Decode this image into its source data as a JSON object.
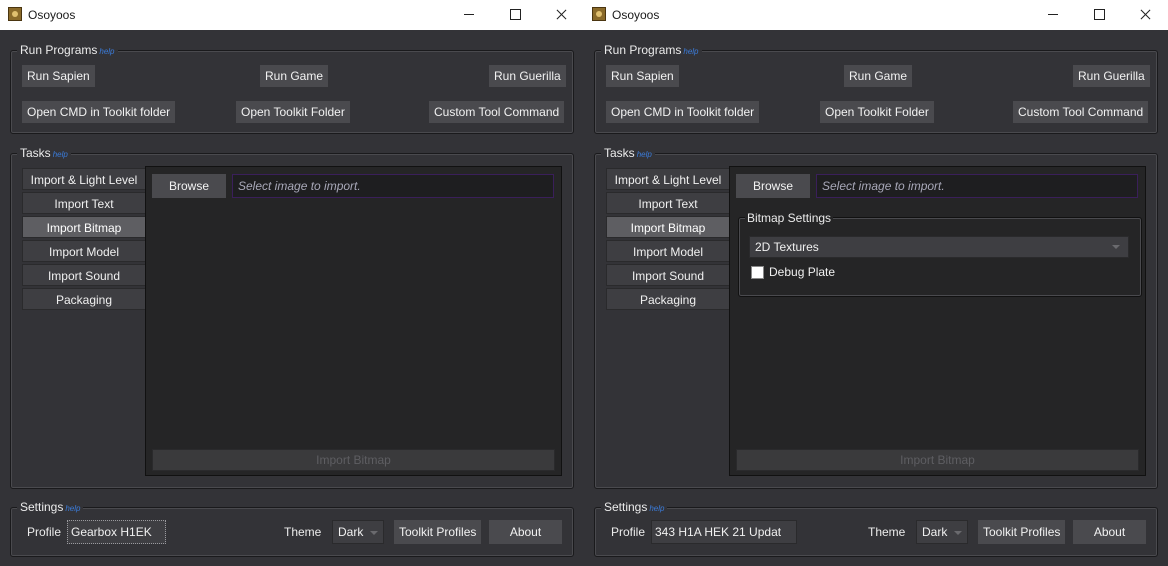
{
  "windows": [
    {
      "title": "Osoyoos",
      "run_programs": {
        "label": "Run Programs",
        "help": "help",
        "buttons": [
          "Run Sapien",
          "Run Game",
          "Run Guerilla",
          "Open CMD in Toolkit folder",
          "Open Toolkit Folder",
          "Custom Tool Command"
        ]
      },
      "tasks": {
        "label": "Tasks",
        "help": "help",
        "tabs": [
          "Import & Light Level",
          "Import Text",
          "Import Bitmap",
          "Import Model",
          "Import Sound",
          "Packaging"
        ],
        "active_tab": "Import Bitmap",
        "browse_label": "Browse",
        "path_placeholder": "Select image to import.",
        "import_label": "Import Bitmap"
      },
      "settings": {
        "label": "Settings",
        "help": "help",
        "profile_label": "Profile",
        "profile_value": "Gearbox H1EK",
        "theme_label": "Theme",
        "theme_value": "Dark",
        "toolkit_profiles_label": "Toolkit Profiles",
        "about_label": "About"
      }
    },
    {
      "title": "Osoyoos",
      "run_programs": {
        "label": "Run Programs",
        "help": "help",
        "buttons": [
          "Run Sapien",
          "Run Game",
          "Run Guerilla",
          "Open CMD in Toolkit folder",
          "Open Toolkit Folder",
          "Custom Tool Command"
        ]
      },
      "tasks": {
        "label": "Tasks",
        "help": "help",
        "tabs": [
          "Import & Light Level",
          "Import Text",
          "Import Bitmap",
          "Import Model",
          "Import Sound",
          "Packaging"
        ],
        "active_tab": "Import Bitmap",
        "browse_label": "Browse",
        "path_placeholder": "Select image to import.",
        "bitmap_settings": {
          "label": "Bitmap Settings",
          "type_value": "2D Textures",
          "debug_plate_label": "Debug Plate",
          "debug_plate_checked": false
        },
        "import_label": "Import Bitmap"
      },
      "settings": {
        "label": "Settings",
        "help": "help",
        "profile_label": "Profile",
        "profile_value": "343 H1A HEK 21 Updat",
        "theme_label": "Theme",
        "theme_value": "Dark",
        "toolkit_profiles_label": "Toolkit Profiles",
        "about_label": "About"
      }
    }
  ]
}
